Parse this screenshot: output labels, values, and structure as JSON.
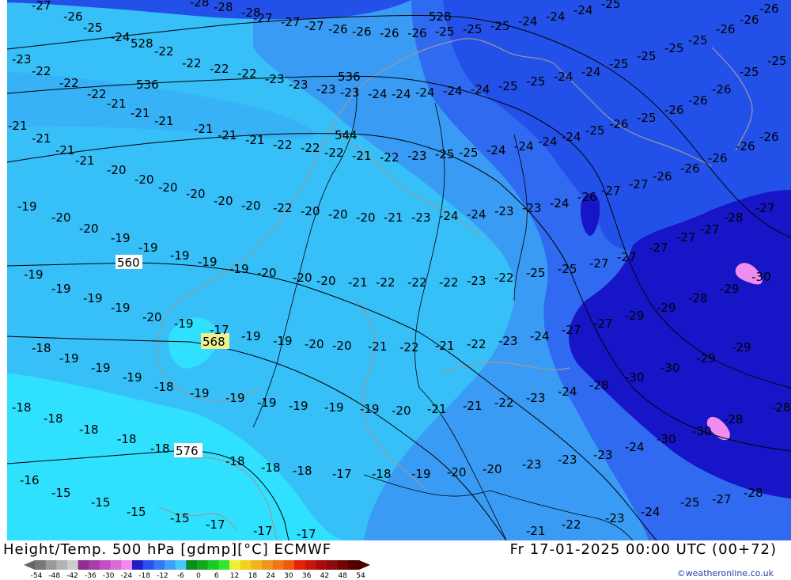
{
  "footer": {
    "title": "Height/Temp. 500 hPa [gdmp][°C] ECMWF",
    "datetime": "Fr 17-01-2025 00:00 UTC (00+72)",
    "credit": "©weatheronline.co.uk",
    "scale_ticks": [
      "-54",
      "-48",
      "-42",
      "-36",
      "-30",
      "-24",
      "-18",
      "-12",
      "-6",
      "0",
      "6",
      "12",
      "18",
      "24",
      "30",
      "36",
      "42",
      "48",
      "54"
    ],
    "scale_colors": [
      "#777777",
      "#999999",
      "#b3b3b3",
      "#cccccc",
      "#8e2e8f",
      "#a63ea8",
      "#c24fc4",
      "#d96ad9",
      "#ef8aef",
      "#1e1ec8",
      "#2850f0",
      "#3478f5",
      "#3ea0fa",
      "#46c8f8",
      "#0a8c1e",
      "#14a81e",
      "#1ec828",
      "#32e632",
      "#f0f032",
      "#f0d21e",
      "#f0b41e",
      "#f0961e",
      "#f07814",
      "#f05a0a",
      "#e61e0a",
      "#c8140a",
      "#aa0a0a",
      "#8c0a0a",
      "#6e0505",
      "#500000"
    ]
  },
  "map": {
    "temperature_labels": [
      "-27",
      "-26",
      "-25",
      "-24",
      "-23",
      "-22",
      "-21",
      "-20",
      "-19",
      "-18",
      "-17",
      "-16",
      "-15",
      "-28",
      "-29",
      "-30"
    ],
    "contour_labels": [
      "528",
      "536",
      "544",
      "560",
      "568",
      "576"
    ],
    "colors": {
      "t_warm": "#30e0ff",
      "t_mid": "#37bff8",
      "t_cool": "#3a9bf4",
      "t_cold": "#2f6af0",
      "t_colder": "#2450ea",
      "t_coldest": "#1616c8",
      "t_extreme": "#f08cf0",
      "highlight": "#f0f08c",
      "coast": "#9a9a9a",
      "border": "#000000"
    }
  }
}
